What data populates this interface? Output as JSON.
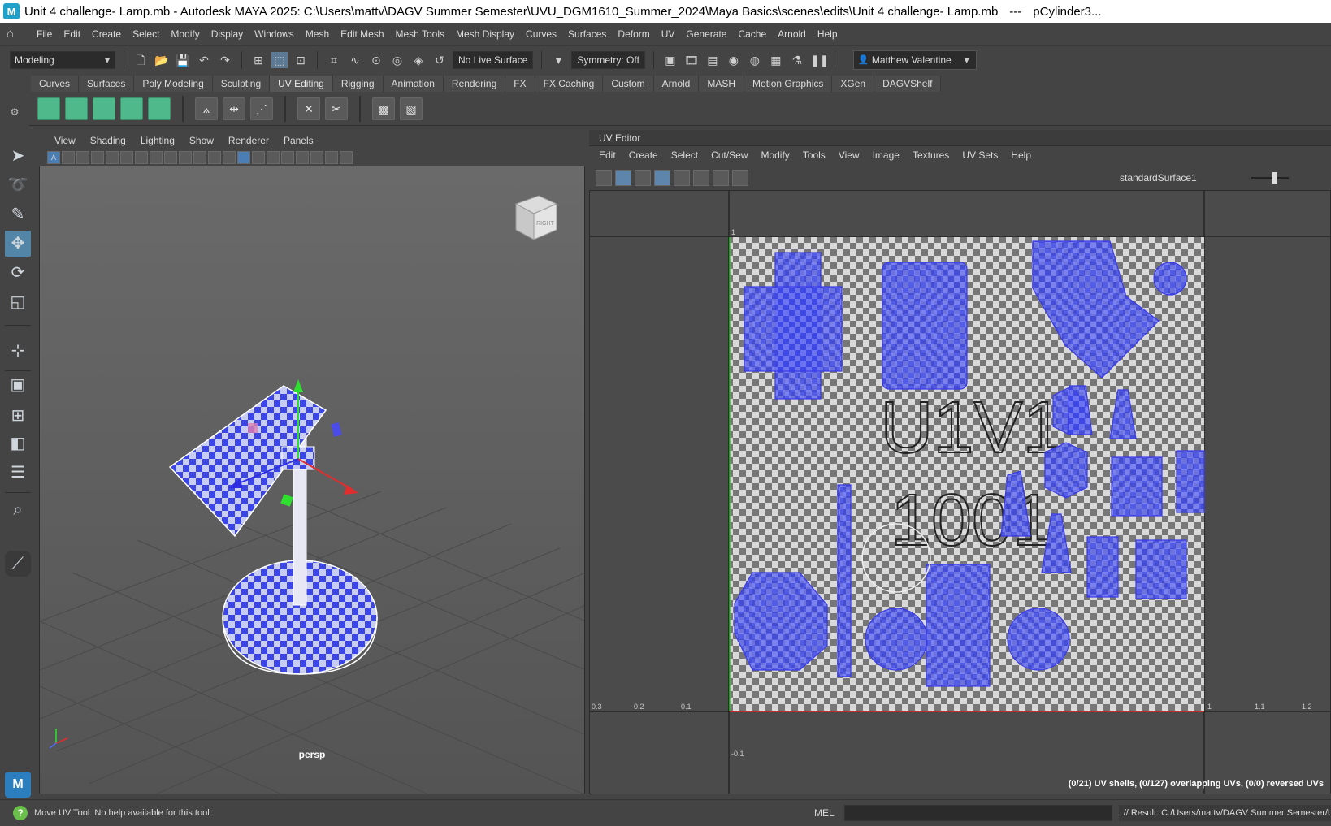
{
  "window": {
    "title": "Unit 4 challenge- Lamp.mb - Autodesk MAYA 2025: C:\\Users\\mattv\\DAGV Summer Semester\\UVU_DGM1610_Summer_2024\\Maya Basics\\scenes\\edits\\Unit 4 challenge- Lamp.mb",
    "separator": "---",
    "selection": "pCylinder3...",
    "app_icon": "M"
  },
  "menubar": {
    "items": [
      "File",
      "Edit",
      "Create",
      "Select",
      "Modify",
      "Display",
      "Windows",
      "Mesh",
      "Edit Mesh",
      "Mesh Tools",
      "Mesh Display",
      "Curves",
      "Surfaces",
      "Deform",
      "UV",
      "Generate",
      "Cache",
      "Arnold",
      "Help"
    ]
  },
  "statusline": {
    "mode": "Modeling",
    "live_surface": "No Live Surface",
    "symmetry": "Symmetry: Off",
    "user": "Matthew Valentine"
  },
  "shelf": {
    "tabs": [
      "Curves",
      "Surfaces",
      "Poly Modeling",
      "Sculpting",
      "UV Editing",
      "Rigging",
      "Animation",
      "Rendering",
      "FX",
      "FX Caching",
      "Custom",
      "Arnold",
      "MASH",
      "Motion Graphics",
      "XGen",
      "DAGVShelf"
    ],
    "active_tab": "UV Editing"
  },
  "viewport": {
    "menu": [
      "View",
      "Shading",
      "Lighting",
      "Show",
      "Renderer",
      "Panels"
    ],
    "camera": "persp",
    "viewcube_face": "RIGHT"
  },
  "uv_editor": {
    "title": "UV Editor",
    "menu": [
      "Edit",
      "Create",
      "Select",
      "Cut/Sew",
      "Modify",
      "Tools",
      "View",
      "Image",
      "Textures",
      "UV Sets",
      "Help"
    ],
    "shader": "standardSurface1",
    "tile_label_line1": "U1V1",
    "tile_label_line2": "1001",
    "axis_labels": [
      "0.3",
      "0.2",
      "0.1",
      "1",
      "1.1",
      "1.2",
      "-0.1",
      "1"
    ],
    "status": "(0/21) UV shells, (0/127) overlapping UVs, (0/0) reversed UVs"
  },
  "helpline": {
    "text": "Move UV Tool: No help available for this tool",
    "mel_label": "MEL",
    "result": "// Result: C:/Users/mattv/DAGV Summer Semester/UV"
  },
  "colors": {
    "uv_shell_blue": "#3c46e6",
    "selection_green": "#4fb98c",
    "active_tool": "#5285a6"
  }
}
